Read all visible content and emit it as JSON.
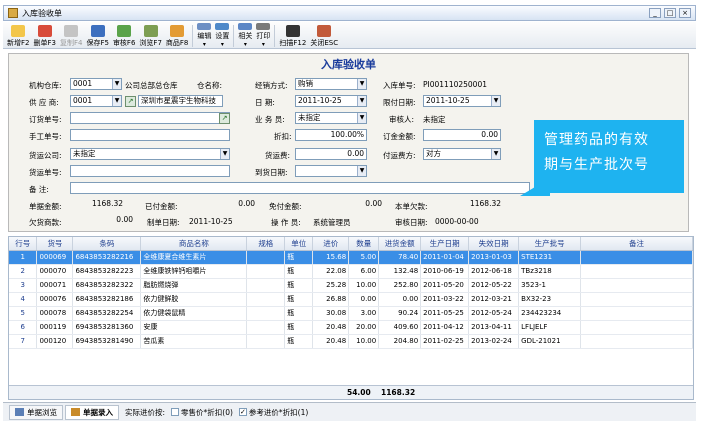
{
  "window": {
    "title": "入库验收单"
  },
  "toolbar": [
    {
      "label": "新增F2",
      "icon": "new-icon",
      "color": "#f3c64a"
    },
    {
      "label": "删单F3",
      "icon": "delete-icon",
      "color": "#d84b3a"
    },
    {
      "label": "复制F4",
      "icon": "copy-icon",
      "color": "#c4c4c4",
      "disabled": true
    },
    {
      "label": "保存F5",
      "icon": "save-icon",
      "color": "#3c6fbf"
    },
    {
      "label": "审核F6",
      "icon": "approve-icon",
      "color": "#5aa34a"
    },
    {
      "label": "浏览F7",
      "icon": "browse-icon",
      "color": "#7d9e52"
    },
    {
      "label": "商品F8",
      "icon": "goods-icon",
      "color": "#e39b34"
    },
    {
      "label": "编辑",
      "icon": "edit-icon",
      "color": "#6d8fc4",
      "caret": true
    },
    {
      "label": "设置",
      "icon": "settings-icon",
      "color": "#4f89c9",
      "caret": true
    },
    {
      "label": "相关",
      "icon": "related-icon",
      "color": "#5b86c6",
      "caret": true
    },
    {
      "label": "打印",
      "icon": "print-icon",
      "color": "#7a7a7a",
      "caret": true
    },
    {
      "label": "扫描F12",
      "icon": "barcode-icon",
      "color": "#333333"
    },
    {
      "label": "关闭ESC",
      "icon": "close-door-icon",
      "color": "#c25a3a"
    }
  ],
  "form": {
    "title": "入库验收单",
    "labels": {
      "institution": "机构仓库:",
      "supplier": "供 应 商:",
      "order_no": "订货单号:",
      "manual_no": "手工单号:",
      "shipping_co": "货运公司:",
      "shipping_no": "货运单号:",
      "remark": "备   注:",
      "amount": "单据金额:",
      "paid": "已付金额:",
      "discount_amount": "免付金额:",
      "due": "本单欠款:",
      "owed_vendor": "欠货商款:",
      "created": "制单日期:",
      "operator": "操 作 员:",
      "audit_date": "审核日期:",
      "warehouse_name": "仓名称:",
      "settle": "经销方式:",
      "date": "日     期:",
      "salesman": "业 务 员:",
      "discount": "折扣:",
      "freight": "货运费:",
      "arrival_date": "到货日期:",
      "receipt_no": "入库单号:",
      "deadline": "限付日期:",
      "auditor": "审核人:",
      "deposit": "订金金额:",
      "freight_payer": "付运费方:"
    },
    "values": {
      "institution_code": "0001",
      "institution_name": "公司总部总仓库",
      "supplier_code": "0001",
      "supplier_name": "深圳市星震宇生物科技",
      "order_no": "",
      "manual_no": "",
      "shipping_co": "未指定",
      "shipping_no": "",
      "remark": "",
      "amount": "1168.32",
      "paid": "0.00",
      "discount_amount": "0.00",
      "due": "1168.32",
      "owed_vendor": "0.00",
      "created": "2011-10-25",
      "operator": "系统管理员",
      "audit_date": "0000-00-00",
      "settle": "购销",
      "date": "2011-10-25",
      "salesman": "未指定",
      "discount": "100.00%",
      "freight": "0.00",
      "arrival_date": "",
      "receipt_no": "PI001110250001",
      "deadline": "2011-10-25",
      "auditor": "未指定",
      "deposit": "0.00",
      "freight_payer": "对方"
    }
  },
  "callout": {
    "line1": "管理药品的有效",
    "line2": "期与生产批次号"
  },
  "grid": {
    "columns": [
      "行号",
      "货号",
      "条码",
      "商品名称",
      "规格",
      "单位",
      "进价",
      "数量",
      "进货金额",
      "生产日期",
      "失效日期",
      "生产批号",
      "备注"
    ],
    "rows": [
      [
        "1",
        "000069",
        "6843853282216",
        "全维康夏合维生素片",
        "",
        "瓶",
        "15.68",
        "5.00",
        "78.40",
        "2011-01-04",
        "2013-01-03",
        "STE1231",
        ""
      ],
      [
        "2",
        "000070",
        "6843853282223",
        "全维康铁锌钙咀嚼片",
        "",
        "瓶",
        "22.08",
        "6.00",
        "132.48",
        "2010-06-19",
        "2012-06-18",
        "TBz3218",
        ""
      ],
      [
        "3",
        "000071",
        "6843853282322",
        "脂肪燃烧弹",
        "",
        "瓶",
        "25.28",
        "10.00",
        "252.80",
        "2011-05-20",
        "2012-05-22",
        "3523-1",
        ""
      ],
      [
        "4",
        "000076",
        "6843853282186",
        "依力健鲜胶",
        "",
        "瓶",
        "26.88",
        "0.00",
        "0.00",
        "2011-03-22",
        "2012-03-21",
        "BX32-23",
        ""
      ],
      [
        "5",
        "000078",
        "6843853282254",
        "依力健袋鼠精",
        "",
        "瓶",
        "30.08",
        "3.00",
        "90.24",
        "2011-05-25",
        "2012-05-24",
        "234423234",
        ""
      ],
      [
        "6",
        "000119",
        "6943853281360",
        "安康",
        "",
        "瓶",
        "20.48",
        "20.00",
        "409.60",
        "2011-04-12",
        "2013-04-11",
        "LFLJELF",
        ""
      ],
      [
        "7",
        "000120",
        "6943853281490",
        "苦瓜素",
        "",
        "瓶",
        "20.48",
        "10.00",
        "204.80",
        "2011-02-25",
        "2013-02-24",
        "GDL-21021",
        ""
      ]
    ],
    "total_qty": "54.00",
    "total_amount": "1168.32"
  },
  "status": {
    "tab_browse": "单据浏览",
    "tab_entry": "单据录入",
    "price_label": "实际进价按:",
    "opt_retail": "零售价*折扣(0)",
    "opt_ref": "参考进价*折扣(1)",
    "opt_ref_checked": true
  }
}
